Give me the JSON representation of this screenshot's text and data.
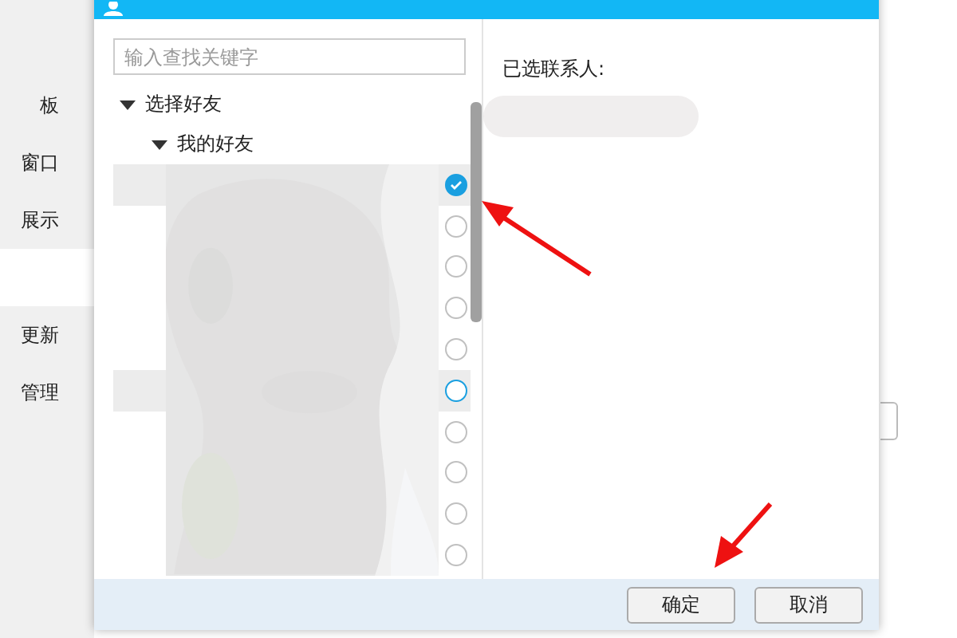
{
  "sidebar": {
    "items": [
      {
        "label": "板",
        "selected": false
      },
      {
        "label": "窗口",
        "selected": false
      },
      {
        "label": "展示",
        "selected": false
      },
      {
        "selected": true
      },
      {
        "label": "更新",
        "selected": false
      },
      {
        "label": "管理",
        "selected": false
      }
    ]
  },
  "dialog": {
    "search": {
      "placeholder": "输入查找关键字"
    },
    "tree": {
      "label": "选择好友",
      "expanded": true,
      "children": [
        {
          "label": "我的好友",
          "expanded": true
        }
      ]
    },
    "contacts": [
      {
        "checked": true,
        "highlighted": true
      },
      {
        "checked": false,
        "highlighted": false
      },
      {
        "checked": false,
        "highlighted": false
      },
      {
        "checked": false,
        "highlighted": false
      },
      {
        "checked": false,
        "highlighted": false
      },
      {
        "checked": false,
        "highlighted": true
      },
      {
        "checked": false,
        "highlighted": false
      },
      {
        "checked": false,
        "highlighted": false
      },
      {
        "checked": false,
        "highlighted": false
      },
      {
        "checked": false,
        "highlighted": false
      }
    ],
    "selected_title": "已选联系人:",
    "buttons": [
      "确定",
      "取消"
    ]
  }
}
